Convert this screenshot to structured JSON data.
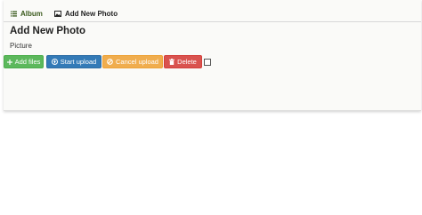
{
  "tabs": [
    {
      "label": "Album",
      "icon": "list-icon"
    },
    {
      "label": "Add New Photo",
      "icon": "image-icon"
    }
  ],
  "page": {
    "title": "Add New Photo",
    "picture_label": "Picture"
  },
  "buttons": {
    "add_files": "Add files",
    "start_upload": "Start upload",
    "cancel_upload": "Cancel upload",
    "delete": "Delete"
  },
  "colors": {
    "success": "#5cb85c",
    "primary": "#337ab7",
    "warning": "#f0ad4e",
    "danger": "#d9534f",
    "active_tab": "#3b5a1d"
  }
}
